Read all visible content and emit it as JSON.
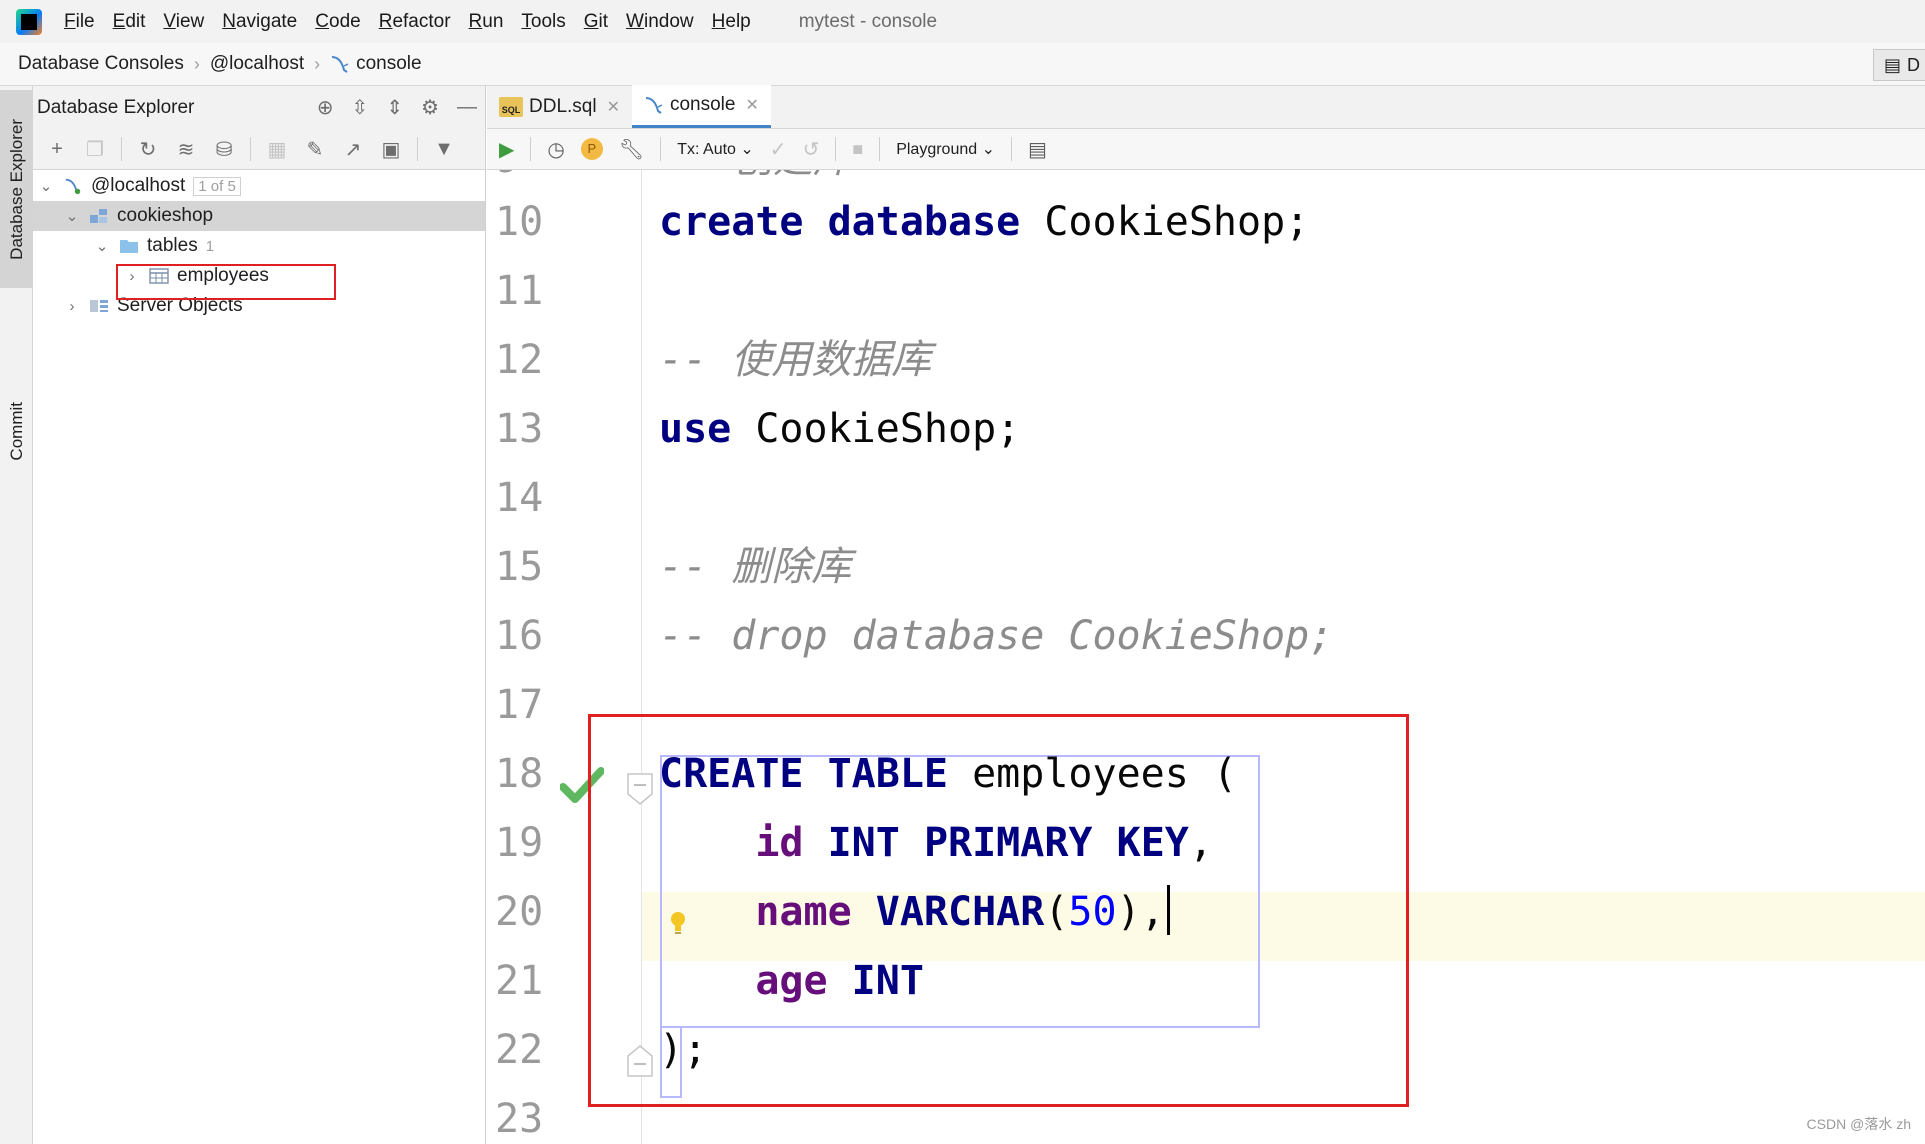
{
  "menubar": {
    "items": [
      "File",
      "Edit",
      "View",
      "Navigate",
      "Code",
      "Refactor",
      "Run",
      "Tools",
      "Git",
      "Window",
      "Help"
    ],
    "window_title": "mytest - console"
  },
  "navbar": {
    "crumbs": [
      "Database Consoles",
      "@localhost",
      "console"
    ],
    "right_button": "D"
  },
  "left_strip": {
    "db_tab": "Database Explorer",
    "commit_tab": "Commit"
  },
  "explorer": {
    "title": "Database Explorer",
    "tree": {
      "host": "@localhost",
      "host_badge": "1 of 5",
      "schema": "cookieshop",
      "tables_folder": "tables",
      "tables_count": "1",
      "table": "employees",
      "server_objects": "Server Objects"
    }
  },
  "editor": {
    "tabs": [
      {
        "label": "DDL.sql",
        "active": false
      },
      {
        "label": "console",
        "active": true
      }
    ],
    "toolbar": {
      "tx_mode": "Tx: Auto",
      "playground": "Playground"
    },
    "lines": [
      {
        "no": "10",
        "text": "create database CookieShop;"
      },
      {
        "no": "11",
        "text": ""
      },
      {
        "no": "12",
        "text": "-- 使用数据库"
      },
      {
        "no": "13",
        "text": "use CookieShop;"
      },
      {
        "no": "14",
        "text": ""
      },
      {
        "no": "15",
        "text": "-- 删除库"
      },
      {
        "no": "16",
        "text": "-- drop database CookieShop;"
      },
      {
        "no": "17",
        "text": ""
      },
      {
        "no": "18",
        "text": "CREATE TABLE employees ("
      },
      {
        "no": "19",
        "text": "id INT PRIMARY KEY,"
      },
      {
        "no": "20",
        "text": "name VARCHAR(50),"
      },
      {
        "no": "21",
        "text": "age INT"
      },
      {
        "no": "22",
        "text": ");"
      },
      {
        "no": "23",
        "text": ""
      }
    ],
    "tokens": {
      "l10_kw1": "create",
      "l10_kw2": "database",
      "l10_rest": " CookieShop;",
      "l12_dash": "-- ",
      "l12_cjk": "使用数据库",
      "l13_kw": "use",
      "l13_rest": " CookieShop;",
      "l15_dash": "-- ",
      "l15_cjk": "删除库",
      "l16_text": "-- drop database CookieShop;",
      "l18_kw1": "CREATE",
      "l18_kw2": "TABLE",
      "l18_rest": " employees (",
      "l19_col": "id",
      "l19_kw1": "INT",
      "l19_kw2": "PRIMARY",
      "l19_kw3": "KEY",
      "l19_rest": ",",
      "l20_col": "name",
      "l20_kw": "VARCHAR",
      "l20_open": "(",
      "l20_num": "50",
      "l20_close": "),",
      "l21_col": "age",
      "l21_kw": "INT",
      "l22_text": ");"
    }
  },
  "watermark": "CSDN @落水 zh",
  "colors": {
    "keyword": "#000080",
    "column": "#660e7a",
    "number": "#0000ff",
    "comment": "#8c8c8c",
    "highlight_box": "#e02020",
    "active_tab_underline": "#4083c9"
  }
}
